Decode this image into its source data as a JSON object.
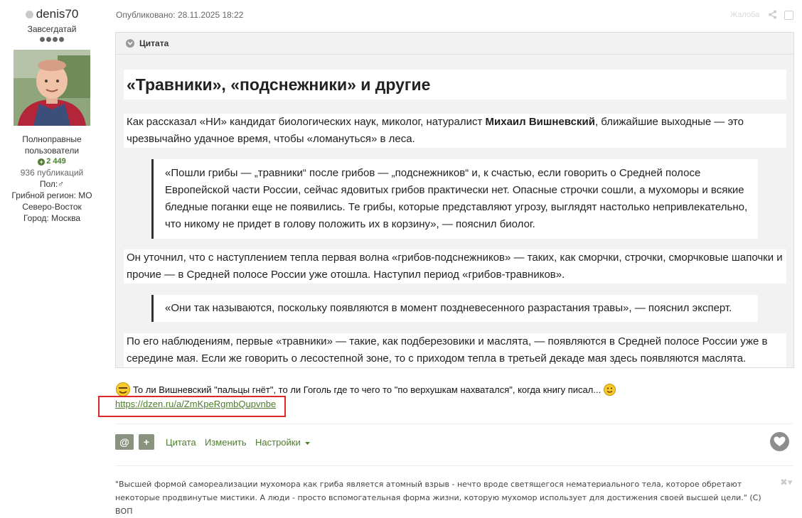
{
  "author": {
    "name": "denis70",
    "rank": "Завсегдатай",
    "group": "Полноправные пользователи",
    "reputation": "2 449",
    "posts": "936 публикаций",
    "gender": "Пол:♂",
    "region": "Грибной регион: МО Северо-Восток",
    "city": "Город: Москва"
  },
  "post": {
    "published": "Опубликовано: 28.11.2025 18:22",
    "report": "Жалоба",
    "quote_label": "Цитата",
    "title": "«Травники», «подснежники» и другие",
    "p1_pre": "Как рассказал «НИ» кандидат биологических наук, миколог, натуралист ",
    "p1_bold": "Михаил Вишневский",
    "p1_post": ", ближайшие выходные — это чрезвычайно удачное время, чтобы «ломануться» в леса.",
    "q1": "«Пошли грибы — „травники“ после грибов — „подснежников“ и, к счастью, если говорить о Средней полосе Европейской части России, сейчас ядовитых грибов практически нет. Опасные строчки сошли, а мухоморы и всякие бледные поганки еще не появились. Те грибы, которые представляют угрозу, выглядят настолько непривлекательно, что никому не придет в голову положить их в корзину», — пояснил биолог.",
    "p2": "Он уточнил, что с наступлением тепла первая волна «грибов-подснежников» — таких, как сморчки, строчки, сморчковые шапочки и прочие — в Средней полосе России уже отошла. Наступил период «грибов-травников».",
    "q2": "«Они так называются, поскольку появляются в момент поздневесенного разрастания травы», — пояснил эксперт.",
    "p3": "По его наблюдениям, первые «травники» — такие, как подберезовики и маслята, — появляются в Средней полосе России уже в середине мая. Если же говорить о лесостепной зоне, то с приходом тепла в третьей декаде мая здесь появляются маслята.",
    "comment": "То ли Вишневский \"пальцы гнёт\", то ли Гоголь где то чего то \"по верхушкам нахватался\", когда книгу писал...",
    "link": "https://dzen.ru/a/ZmKpeRgmbQupvnbe"
  },
  "actions": {
    "mention": "@",
    "plus": "+",
    "quote": "Цитата",
    "edit": "Изменить",
    "settings": "Настройки"
  },
  "signature": "\"Высшей формой самореализации мухомора как гриба является атомный взрыв - нечто вроде светящегося нематериального тела, которое обретают некоторые продвинутые мистики. А люди - просто вспомогательная форма жизни, которую мухомор использует для достижения своей высшей цели.\" (С) ВОП",
  "icons": [
    "status-dot-icon",
    "chevron-down-icon",
    "share-icon",
    "heart-icon",
    "emoji-icon",
    "close-icon",
    "plus-circle-icon"
  ],
  "colors": {
    "accent": "#4e7d2e",
    "highlight": "#e0262b",
    "button": "#8a9380"
  }
}
